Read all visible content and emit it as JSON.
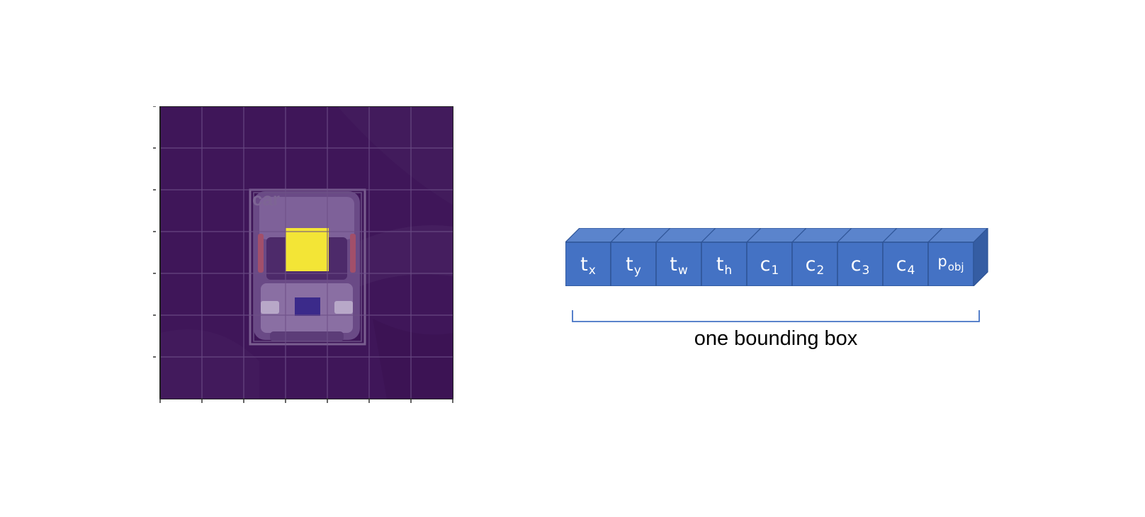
{
  "image_panel": {
    "grid_rows": 7,
    "grid_cols": 7,
    "object_label": "car",
    "highlight_color": "#f3e536",
    "background_color": "#3f1659"
  },
  "vector": {
    "cells": [
      {
        "main": "t",
        "sub": "x"
      },
      {
        "main": "t",
        "sub": "y"
      },
      {
        "main": "t",
        "sub": "w"
      },
      {
        "main": "t",
        "sub": "h"
      },
      {
        "main": "c",
        "sub": "1"
      },
      {
        "main": "c",
        "sub": "2"
      },
      {
        "main": "c",
        "sub": "3"
      },
      {
        "main": "c",
        "sub": "4"
      },
      {
        "main": "p",
        "sub": "obj"
      }
    ],
    "face_color": "#4472c4",
    "top_color": "#5b84cc",
    "side_color": "#355da3",
    "edge_color": "#2f5597"
  },
  "brace": {
    "label": "one bounding box",
    "color": "#4472c4"
  }
}
